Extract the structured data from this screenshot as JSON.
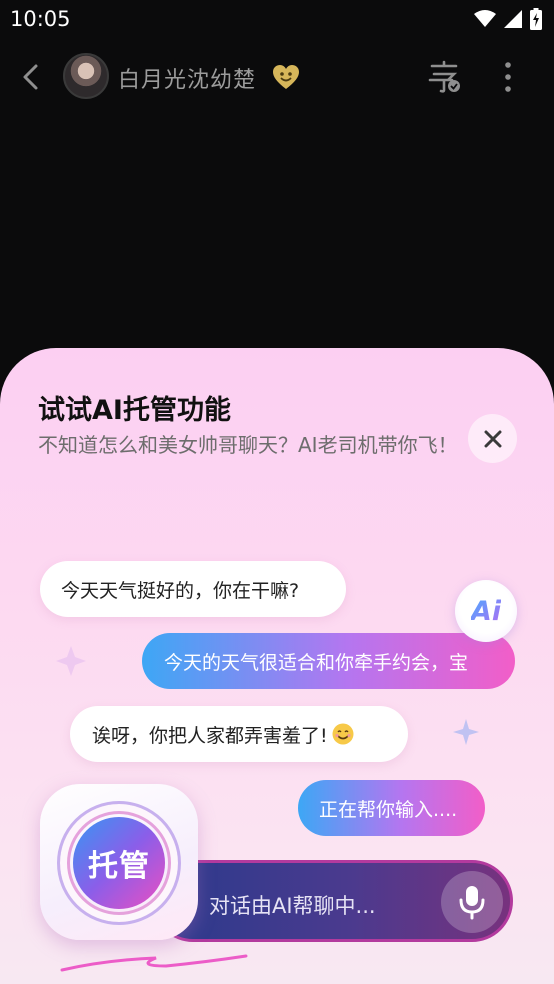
{
  "status_bar": {
    "time": "10:05"
  },
  "header": {
    "contact_name": "白月光沈幼楚"
  },
  "sheet": {
    "title": "试试AI托管功能",
    "subtitle": "不知道怎么和美女帅哥聊天？AI老司机带你飞！",
    "ai_badge": "Ai",
    "messages": [
      {
        "text": "今天天气挺好的，你在干嘛?",
        "side": "left"
      },
      {
        "text": "今天的天气很适合和你牵手约会，宝",
        "side": "right"
      },
      {
        "text": "诶呀，你把人家都弄害羞了!",
        "side": "left"
      },
      {
        "text": "正在帮你输入....",
        "side": "right"
      }
    ],
    "managed_button_label": "托管",
    "input_status": "对话由AI帮聊中..."
  },
  "colors": {
    "accent_blue": "#3da7f5",
    "accent_pink": "#f25ec8",
    "sheet_bg": "#fccff2",
    "background": "#0b0b0c"
  }
}
